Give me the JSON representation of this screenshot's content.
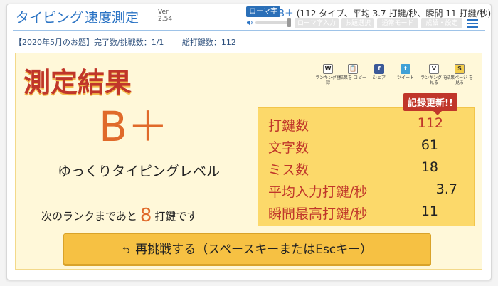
{
  "header": {
    "app_title_kana": "タイピング",
    "app_title_kanji": "速度測定",
    "version_label": "Ver",
    "version_number": "2.54",
    "mode_badge": "ローマ字",
    "rank_letter": "B＋",
    "rank_summary": "(112 タイプ、平均 3.7 打鍵/秒、瞬間 11 打鍵/秒)",
    "buttons": [
      "ローマ字入力",
      "お題選択",
      "通常モード",
      "成績・設定"
    ]
  },
  "subheader": {
    "problem": "【2020年5月のお題】完了数/挑戦数：1/1",
    "total": "総打鍵数：112"
  },
  "result": {
    "title": "測定結果",
    "actions": [
      {
        "icon": "W",
        "label": "ランキング登録"
      },
      {
        "icon": "📋",
        "label": "結果を コピー"
      },
      {
        "icon": "f",
        "label": "シェア"
      },
      {
        "icon": "t",
        "label": "ツイート"
      },
      {
        "icon": "V",
        "label": "ランキング を見る"
      },
      {
        "icon": "S",
        "label": "結果ページ を見る"
      }
    ],
    "rank": "B＋",
    "level": "ゆっくりタイピングレベル",
    "next_prefix": "次のランクまであと",
    "next_value": "8",
    "next_suffix": "打鍵です",
    "record_badge": "記録更新!!",
    "stats": [
      {
        "label": "打鍵数",
        "value": "112"
      },
      {
        "label": "文字数",
        "value": "61"
      },
      {
        "label": "ミス数",
        "value": "18"
      },
      {
        "label": "平均入力打鍵/秒",
        "value": "3.7"
      },
      {
        "label": "瞬間最高打鍵/秒",
        "value": "11"
      }
    ],
    "retry_icon": "⮌",
    "retry_label": "再挑戦する（スペースキーまたはEscキー）"
  },
  "colors": {
    "accent_blue": "#2a73c4",
    "result_red": "#c0362a",
    "rank_orange": "#e06a2a",
    "panel_yellow": "#fcd96a",
    "button_yellow": "#f6c143"
  }
}
